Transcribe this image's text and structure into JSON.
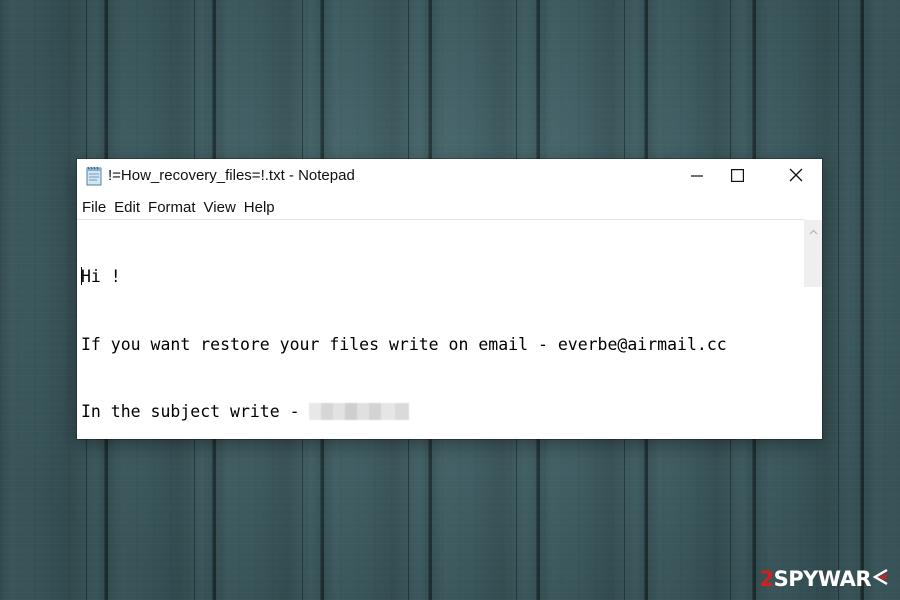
{
  "window": {
    "title": "!=How_recovery_files=!.txt - Notepad",
    "controls": {
      "minimize": "minimize",
      "maximize": "maximize",
      "close": "close"
    }
  },
  "menu": {
    "items": [
      {
        "label": "File"
      },
      {
        "label": "Edit"
      },
      {
        "label": "Format"
      },
      {
        "label": "View"
      },
      {
        "label": "Help"
      }
    ]
  },
  "document": {
    "lines": [
      {
        "text": "Hi !"
      },
      {
        "text": "If you want restore your files write on email - everbe@airmail.cc"
      },
      {
        "text": "In the subject write - "
      }
    ],
    "redacted_value": true
  },
  "watermark": {
    "number": "2",
    "name": "SPYWAR",
    "mark": "E"
  },
  "colors": {
    "wall": "#3f5f64",
    "window_bg": "#ffffff",
    "watermark_red": "#d21f1f",
    "watermark_white": "#ffffff"
  },
  "icons": {
    "app": "notepad-icon",
    "minimize": "minimize-icon",
    "maximize": "maximize-icon",
    "close": "close-icon",
    "scroll_up": "chevron-up-icon"
  }
}
